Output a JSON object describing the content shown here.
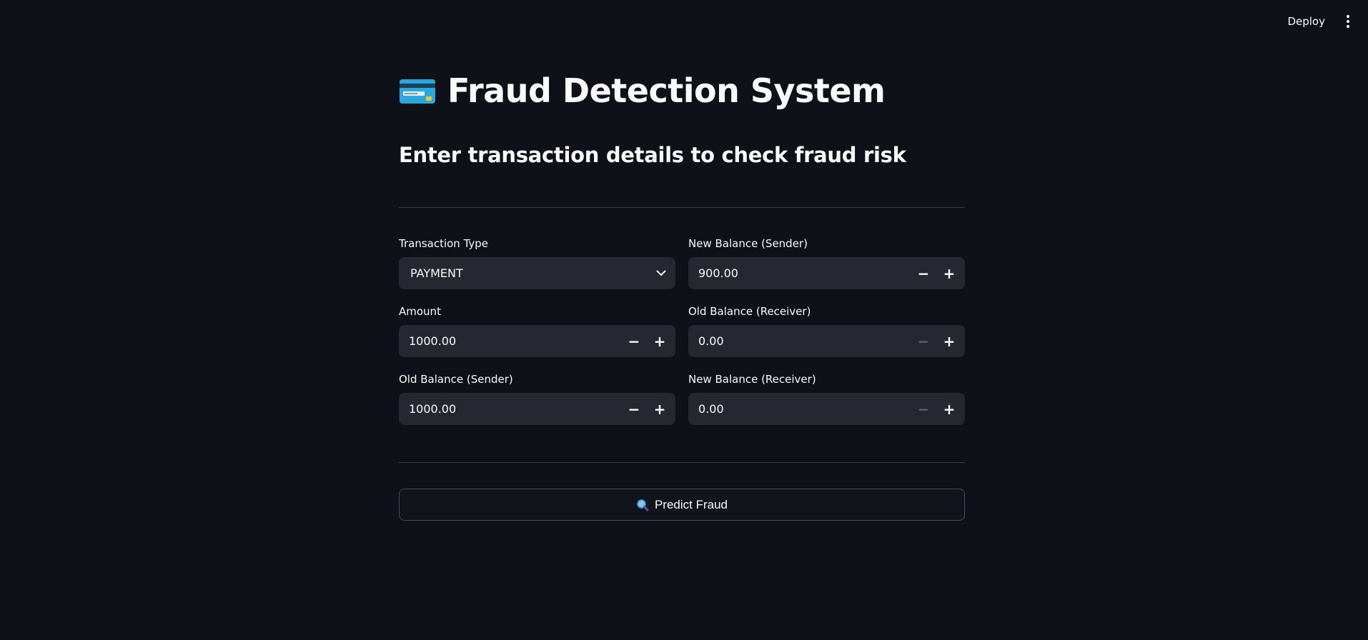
{
  "toolbar": {
    "deploy_label": "Deploy",
    "menu_icon": "kebab-menu-icon"
  },
  "header": {
    "icon": "credit-card-icon",
    "title": "Fraud Detection System",
    "subtitle": "Enter transaction details to check fraud risk"
  },
  "form": {
    "transaction_type": {
      "label": "Transaction Type",
      "value": "PAYMENT"
    },
    "amount": {
      "label": "Amount",
      "value": "1000.00"
    },
    "old_balance_sender": {
      "label": "Old Balance (Sender)",
      "value": "1000.00"
    },
    "new_balance_sender": {
      "label": "New Balance (Sender)",
      "value": "900.00"
    },
    "old_balance_receiver": {
      "label": "Old Balance (Receiver)",
      "value": "0.00"
    },
    "new_balance_receiver": {
      "label": "New Balance (Receiver)",
      "value": "0.00"
    },
    "stepper": {
      "minus": "−",
      "plus": "+"
    }
  },
  "action": {
    "icon": "magnifying-glass-icon",
    "predict_label": "Predict Fraud"
  },
  "colors": {
    "background": "#0e1117",
    "input_background": "#262730",
    "text": "#fafafa",
    "divider": "#3a3d46"
  }
}
